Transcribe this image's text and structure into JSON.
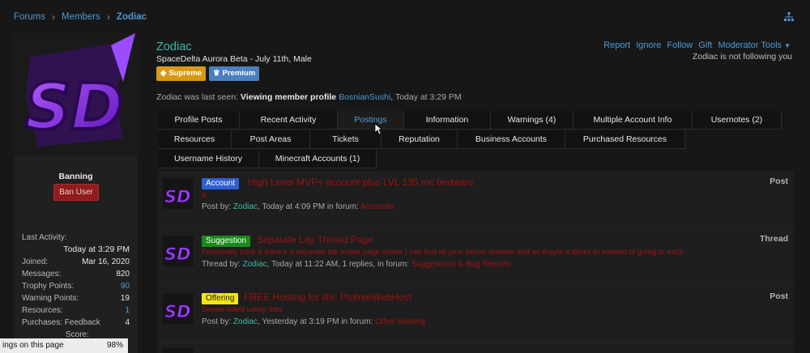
{
  "breadcrumb": [
    "Forums",
    "Members",
    "Zodiac"
  ],
  "profile": {
    "name": "Zodiac",
    "meta": "SpaceDelta Aurora Beta - July 11th, Male",
    "badges": [
      "Supreme",
      "Premium"
    ],
    "last_seen_label": "Zodiac was last seen:",
    "last_seen_action": "Viewing member profile",
    "last_seen_target": "BosnianSushi",
    "last_seen_time": ", Today at 3:29 PM",
    "avatar_text": "SD"
  },
  "actions": [
    "Report",
    "Ignore",
    "Follow",
    "Gift",
    "Moderator Tools"
  ],
  "follow_note": "Zodiac is not following you",
  "tabs": {
    "row1": [
      "Profile Posts",
      "Recent Activity",
      "Postings",
      "Information",
      "Warnings (4)",
      "Multiple Account Info",
      "Usernotes (2)"
    ],
    "row2": [
      "Resources",
      "Post Areas",
      "Tickets",
      "Reputation",
      "Business Accounts",
      "Purchased Resources"
    ],
    "row3": [
      "Username History",
      "Minecraft Accounts (1)"
    ],
    "active": "Postings"
  },
  "sidebar": {
    "banning_label": "Banning",
    "ban_button": "Ban User",
    "last_activity_label": "Last Activity:",
    "last_activity_value": "Today at 3:29 PM",
    "stats": [
      {
        "label": "Joined:",
        "value": "Mar 16, 2020"
      },
      {
        "label": "Messages:",
        "value": "820"
      },
      {
        "label": "Trophy Points:",
        "value": "90"
      },
      {
        "label": "Warning Points:",
        "value": "19"
      },
      {
        "label": "Resources:",
        "value": "1"
      },
      {
        "label": "Purchases: Feedback",
        "value": "4"
      }
    ],
    "score_label": "Score:"
  },
  "toast": {
    "text": "ings on this page",
    "value": "98%"
  },
  "results": [
    {
      "prefix": "Account",
      "prefix_style": "account",
      "title": "High Level MVP+ account plus LVL 135 mc bedwars",
      "snippet": "p",
      "meta_prefix": "Post by:",
      "user": "Zodiac",
      "meta_time": ", Today at 4:09 PM in forum:",
      "forum": "Accounts",
      "type": "Post"
    },
    {
      "prefix": "Suggestion",
      "prefix_style": "suggestion",
      "title": "Separate Lay Thread Page",
      "snippet": "Personally think it there's a separate tab inside page where I can find all your server threads and as theyre it dlinks to instead of going to each",
      "meta_prefix": "Thread by:",
      "user": "Zodiac",
      "meta_time": ", Today at 11:22 AM, 1 replies, in forum:",
      "forum": "Suggestions & Bug Reports",
      "type": "Thread"
    },
    {
      "prefix": "Offering",
      "prefix_style": "offering",
      "title": "FREE Hosting for life: ProfreeWebHost",
      "snippet": "Server listed using: lists",
      "meta_prefix": "Post by:",
      "user": "Zodiac",
      "meta_time": ", Yesterday at 3:19 PM in forum:",
      "forum": "Other Hosting",
      "type": "Post"
    }
  ],
  "colors": {
    "accent": "#4f9ad6",
    "username": "#3fb9a9",
    "link_red": "#a21212",
    "avatar_purple": "#8a2be2"
  }
}
